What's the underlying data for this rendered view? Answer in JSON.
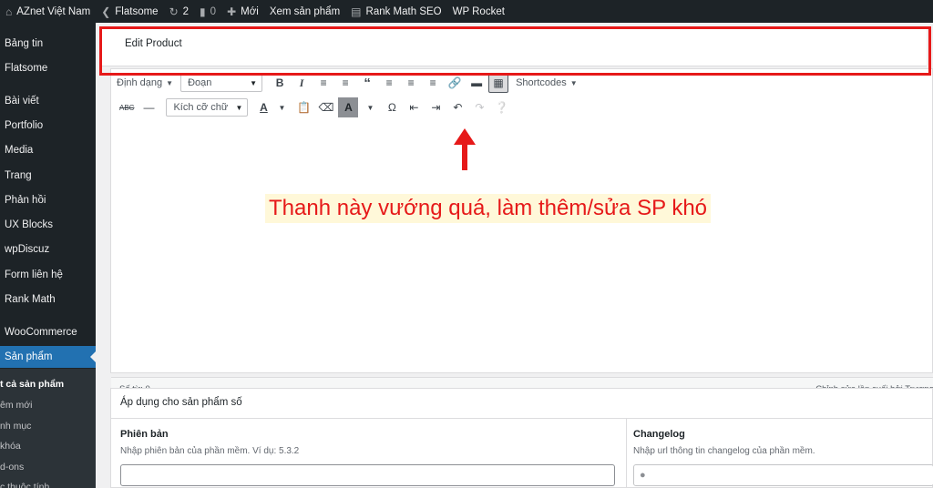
{
  "admin_bar": {
    "site_name": "AZnet Việt Nam",
    "theme": "Flatsome",
    "updates_count": "2",
    "comments_count": "0",
    "new_label": "Mới",
    "view_product": "Xem sản phẩm",
    "rank_math": "Rank Math SEO",
    "wp_rocket": "WP Rocket"
  },
  "sidebar": {
    "items": [
      {
        "label": "Bảng tin"
      },
      {
        "label": "Flatsome"
      },
      {
        "label": "Bài viết"
      },
      {
        "label": "Portfolio"
      },
      {
        "label": "Media"
      },
      {
        "label": "Trang"
      },
      {
        "label": "Phản hồi"
      },
      {
        "label": "UX Blocks"
      },
      {
        "label": "wpDiscuz"
      },
      {
        "label": "Form liên hệ"
      },
      {
        "label": "Rank Math"
      },
      {
        "label": "WooCommerce"
      },
      {
        "label": "Sản phẩm"
      }
    ],
    "submenu": [
      {
        "label": "t cả sản phẩm"
      },
      {
        "label": "êm mới"
      },
      {
        "label": "nh mục"
      },
      {
        "label": "khóa"
      },
      {
        "label": "d-ons"
      },
      {
        "label": "c thuộc tính"
      }
    ]
  },
  "header": {
    "title": "Edit Product"
  },
  "toolbar": {
    "format_label": "Định dạng",
    "paragraph_label": "Đoạn",
    "shortcodes_label": "Shortcodes",
    "font_size_label": "Kích cỡ chữ"
  },
  "annotation": {
    "text": "Thanh này vướng quá, làm thêm/sửa SP khó",
    "color": "#e61919"
  },
  "statusbar": {
    "word_count": "Số từ: 0",
    "last_edited": "Chỉnh sửa lần cuối bởi Trương"
  },
  "metabox": {
    "title": "Áp dụng cho sản phẩm số",
    "version_label": "Phiên bản",
    "version_desc": "Nhập phiên bản của phần mềm. Ví dụ: 5.3.2",
    "changelog_label": "Changelog",
    "changelog_desc": "Nhập url thông tin changelog của phần mềm."
  },
  "colors": {
    "admin_dark": "#1d2327",
    "accent": "#2271b1",
    "highlight": "#e61919"
  }
}
